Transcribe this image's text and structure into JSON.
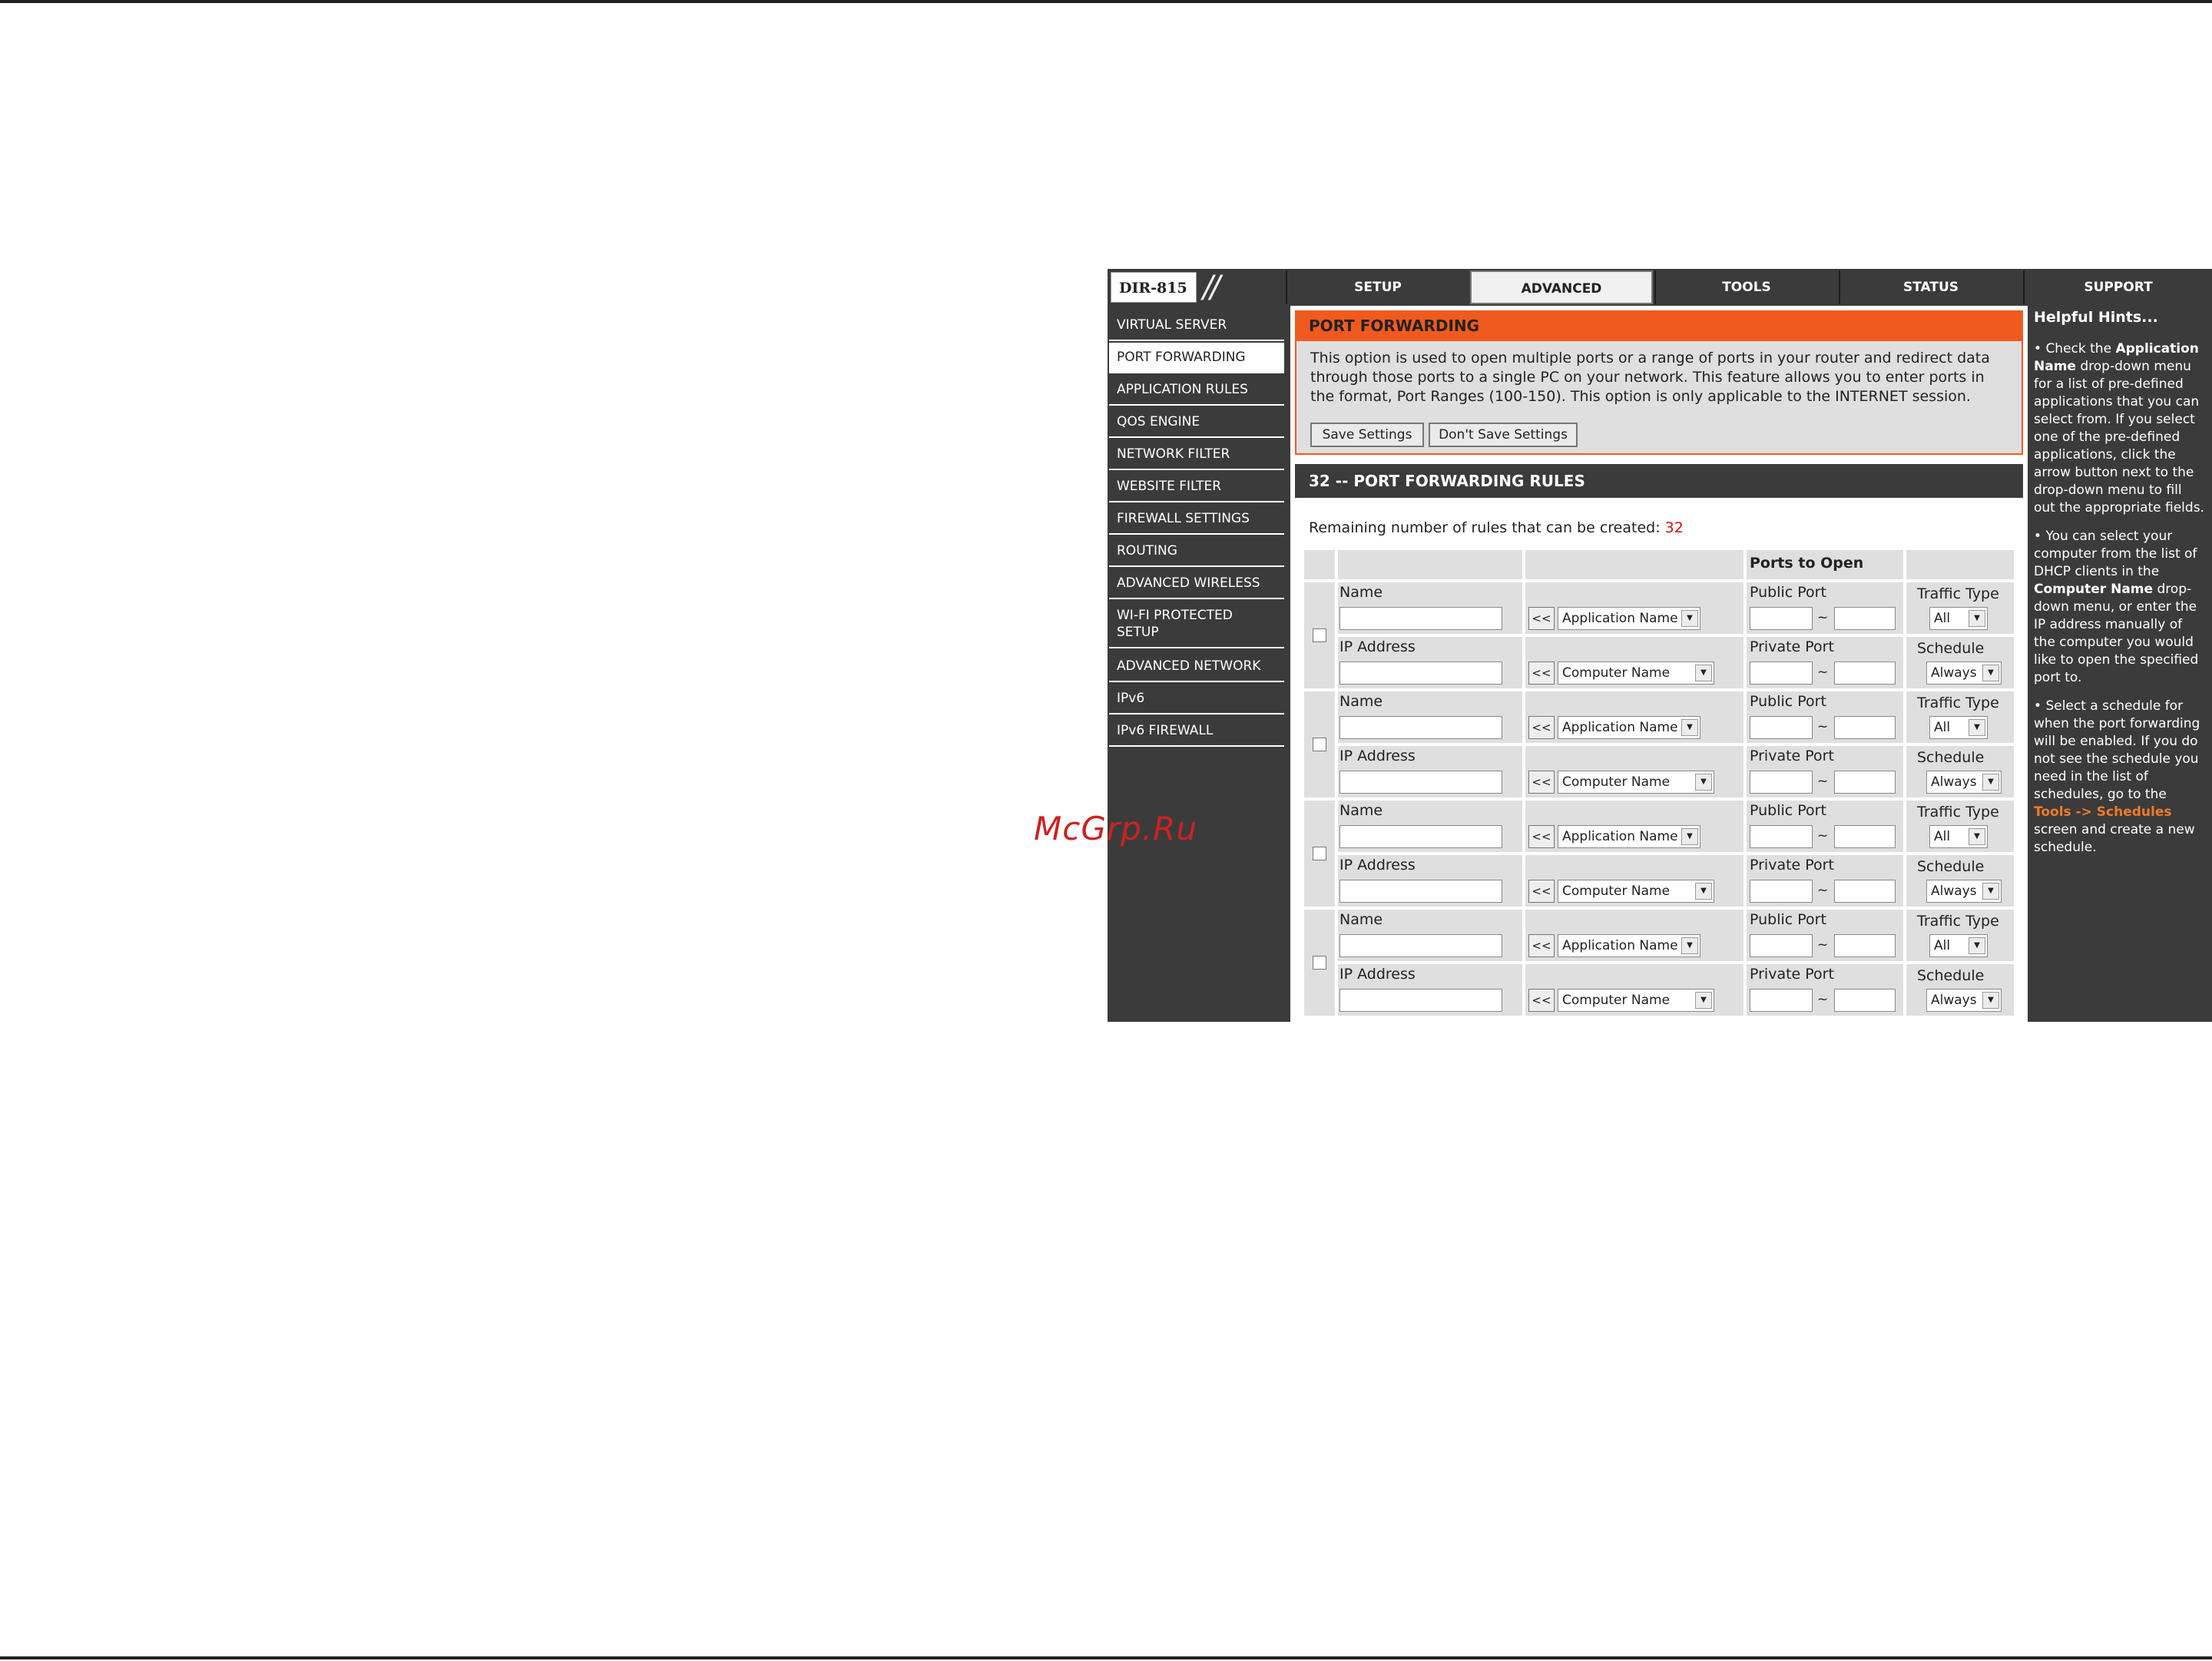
{
  "watermark": "McGrp.Ru",
  "logo": {
    "model": "DIR-815",
    "slashes": "//"
  },
  "tabs": [
    {
      "label": "SETUP"
    },
    {
      "label": "ADVANCED"
    },
    {
      "label": "TOOLS"
    },
    {
      "label": "STATUS"
    },
    {
      "label": "SUPPORT"
    }
  ],
  "sidebar": {
    "items": [
      {
        "label": "VIRTUAL SERVER"
      },
      {
        "label": "PORT FORWARDING"
      },
      {
        "label": "APPLICATION RULES"
      },
      {
        "label": "QOS ENGINE"
      },
      {
        "label": "NETWORK FILTER"
      },
      {
        "label": "WEBSITE FILTER"
      },
      {
        "label": "FIREWALL SETTINGS"
      },
      {
        "label": "ROUTING"
      },
      {
        "label": "ADVANCED WIRELESS"
      },
      {
        "label": "WI-FI PROTECTED SETUP"
      },
      {
        "label": "ADVANCED NETWORK"
      },
      {
        "label": "IPv6"
      },
      {
        "label": "IPv6 FIREWALL"
      }
    ]
  },
  "port_forwarding": {
    "title": "PORT FORWARDING",
    "description": "This option is used to open multiple ports or a range of ports in your router and redirect data through those ports to a single PC on your network. This feature allows you to enter ports in the format, Port Ranges (100-150). This option is only applicable to the INTERNET session.",
    "save_label": "Save Settings",
    "dont_save_label": "Don't Save Settings"
  },
  "rules": {
    "title": "32 -- PORT FORWARDING RULES",
    "remaining_label": "Remaining number of rules that can be created:",
    "remaining_count": "32",
    "ports_to_open": "Ports to Open",
    "labels": {
      "name": "Name",
      "ip_address": "IP Address",
      "public_port": "Public Port",
      "private_port": "Private Port",
      "traffic_type": "Traffic Type",
      "schedule": "Schedule",
      "arrow": "<<",
      "tilde": "~",
      "application_name": "Application Name",
      "computer_name": "Computer Name",
      "traffic_value": "All",
      "schedule_value": "Always",
      "dropdown_glyph": "▼"
    }
  },
  "hints": {
    "title": "Helpful Hints...",
    "hint1_a": "Check the ",
    "hint1_b": "Application Name",
    "hint1_c": " drop-down menu for a list of pre-defined applications that you can select from. If you select one of the pre-defined applications, click the arrow button next to the drop-down menu to fill out the appropriate fields.",
    "hint2_a": "You can select your computer from the list of DHCP clients in the ",
    "hint2_b": "Computer Name",
    "hint2_c": " drop-down menu, or enter the IP address manually of the computer you would like to open the specified port to.",
    "hint3_a": "Select a schedule for when the port forwarding will be enabled. If you do not see the schedule you need in the list of schedules, go to the ",
    "hint3_link": "Tools -> Schedules",
    "hint3_c": " screen and create a new schedule."
  }
}
